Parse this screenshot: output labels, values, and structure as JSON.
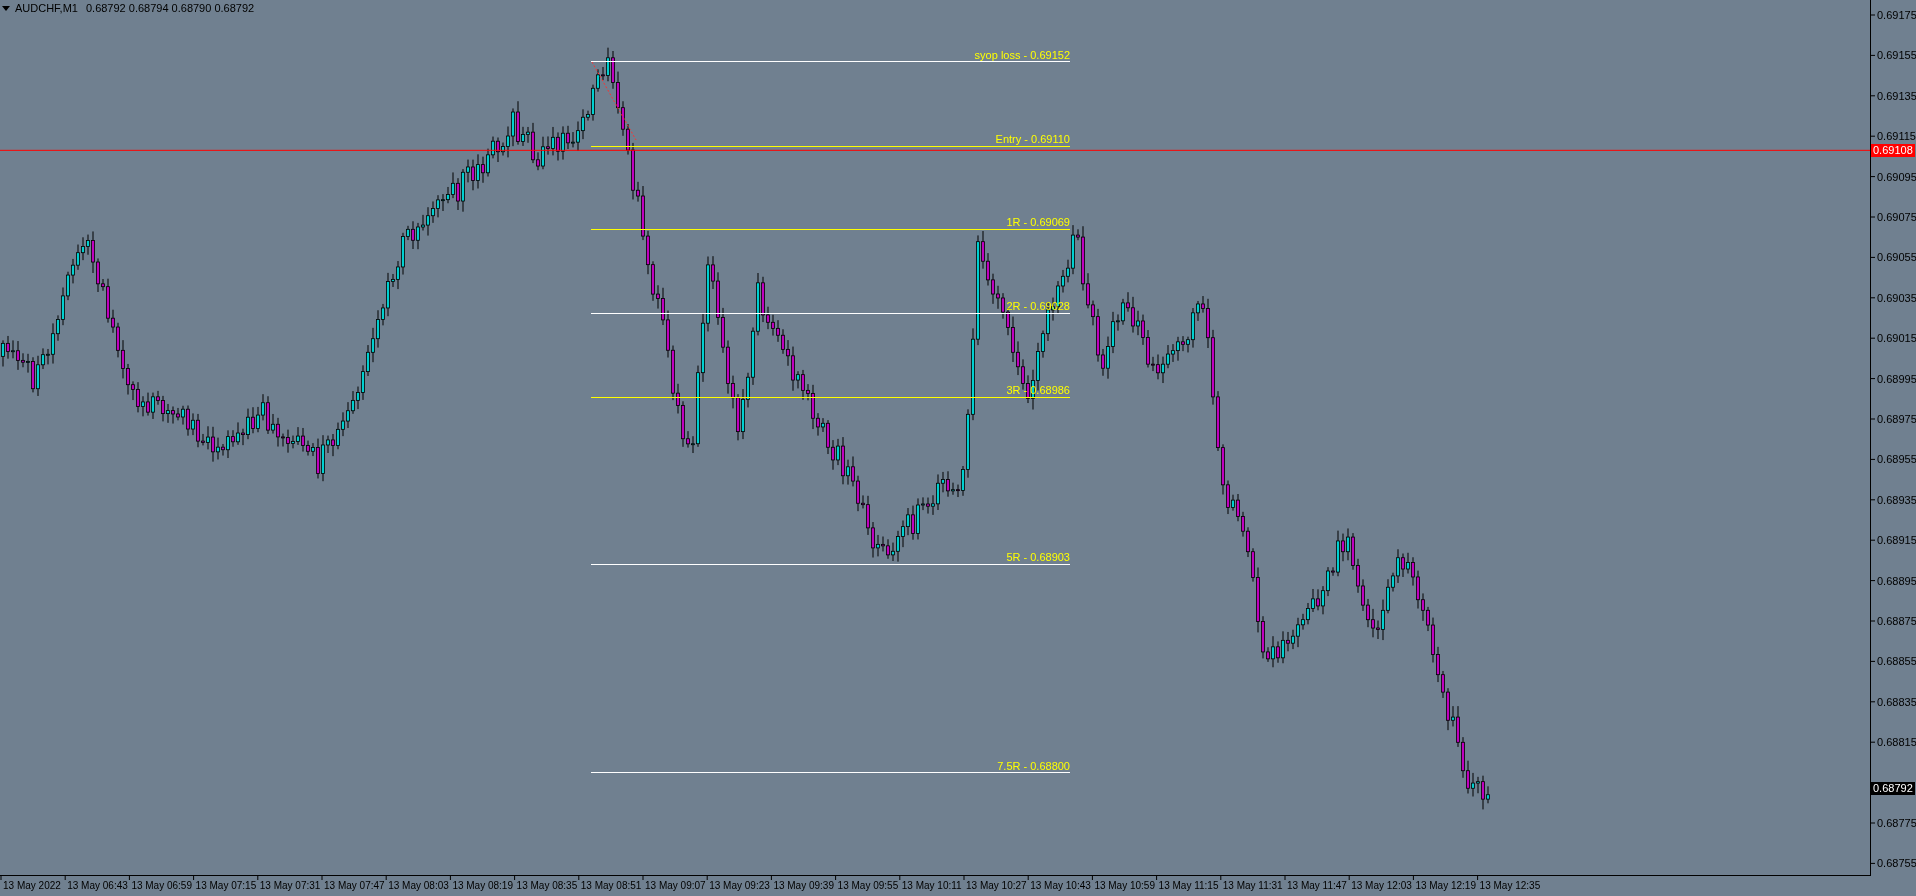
{
  "header": {
    "symbol": "AUDCHF,M1",
    "prices": "0.68792 0.68794 0.68790 0.68792"
  },
  "levels": [
    {
      "label": "syop loss - 0.69152",
      "color": "#ffffff"
    },
    {
      "label": "Entry - 0.69110",
      "color": "#ffff00"
    },
    {
      "label": "1R - 0.69069",
      "color": "#ffff00"
    },
    {
      "label": "2R - 0.69028",
      "color": "#ffffff"
    },
    {
      "label": "3R - 0.68986",
      "color": "#ffff00"
    },
    {
      "label": "5R - 0.68903",
      "color": "#ffffff"
    },
    {
      "label": "7.5R - 0.68800",
      "color": "#ffffff"
    }
  ],
  "price_axis": {
    "ticks": [
      "0.69175",
      "0.69155",
      "0.69135",
      "0.69115",
      "0.69095",
      "0.69075",
      "0.69055",
      "0.69035",
      "0.69015",
      "0.68995",
      "0.68975",
      "0.68955",
      "0.68935",
      "0.68915",
      "0.68895",
      "0.68875",
      "0.68855",
      "0.68835",
      "0.68815",
      "0.68775",
      "0.68755"
    ],
    "marker_line": "0.69108",
    "bid": "0.68792"
  },
  "time_axis": [
    "13 May 2022",
    "13 May 06:43",
    "13 May 06:59",
    "13 May 07:15",
    "13 May 07:31",
    "13 May 07:47",
    "13 May 08:03",
    "13 May 08:19",
    "13 May 08:35",
    "13 May 08:51",
    "13 May 09:07",
    "13 May 09:23",
    "13 May 09:39",
    "13 May 09:55",
    "13 May 10:11",
    "13 May 10:27",
    "13 May 10:43",
    "13 May 10:59",
    "13 May 11:15",
    "13 May 11:31",
    "13 May 11:47",
    "13 May 12:03",
    "13 May 12:19",
    "13 May 12:35"
  ]
}
